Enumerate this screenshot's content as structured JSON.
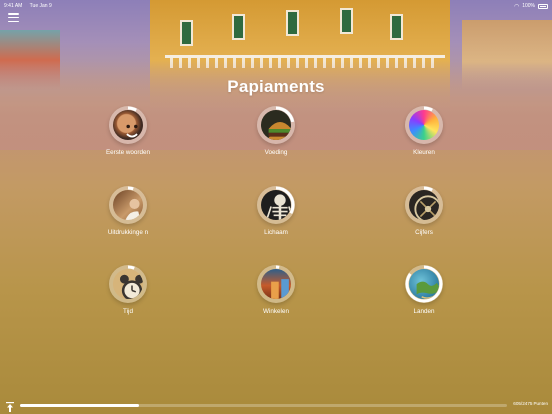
{
  "status_bar": {
    "time": "9:41 AM",
    "date": "Tue Jan 9",
    "battery": "100%"
  },
  "title": "Papiaments",
  "categories": [
    {
      "label": "Eerste woorden",
      "progress": 0.08,
      "icon": "boy-face-icon"
    },
    {
      "label": "Voeding",
      "progress": 0.22,
      "icon": "burger-icon"
    },
    {
      "label": "Kleuren",
      "progress": 0.08,
      "icon": "color-swirl-icon"
    },
    {
      "label": "Uitdrukkinge n",
      "progress": 0.05,
      "icon": "gesture-icon"
    },
    {
      "label": "Lichaam",
      "progress": 0.33,
      "icon": "skeleton-icon"
    },
    {
      "label": "Cijfers",
      "progress": 0.08,
      "icon": "numbers-icon"
    },
    {
      "label": "Tijd",
      "progress": 0.06,
      "icon": "alarm-clock-icon"
    },
    {
      "label": "Winkelen",
      "progress": 0.03,
      "icon": "shopping-icon"
    },
    {
      "label": "Landen",
      "progress": 0.85,
      "icon": "globe-map-icon"
    }
  ],
  "footer": {
    "points_value": "605/2475",
    "points_label": "Punten",
    "overall_progress": 0.244
  },
  "colors": {
    "ring_progress": "#ffffff",
    "ring_track": "rgba(255,255,255,0.35)"
  }
}
